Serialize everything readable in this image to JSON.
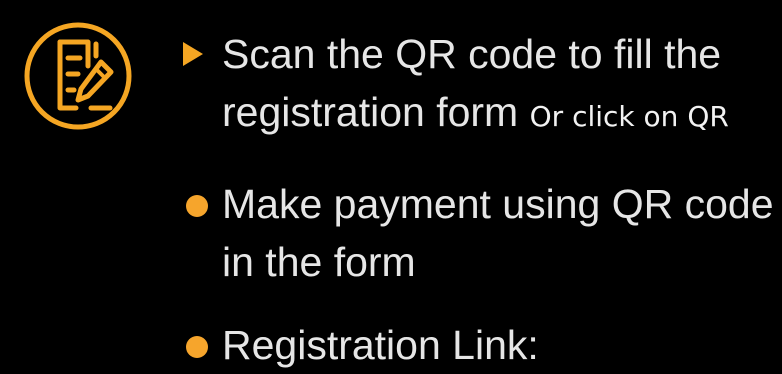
{
  "colors": {
    "accent": "#f5a623",
    "background": "#000000",
    "text": "#e6e6e6"
  },
  "icon": "form-edit-icon",
  "steps": [
    {
      "marker": "arrow",
      "line1": "Scan the QR code to fill the",
      "line2": "registration form",
      "note": "Or click on QR"
    },
    {
      "marker": "dot",
      "line1": "Make payment using QR code",
      "line2": "in the form"
    },
    {
      "marker": "dot",
      "line1": "Registration Link:"
    }
  ]
}
